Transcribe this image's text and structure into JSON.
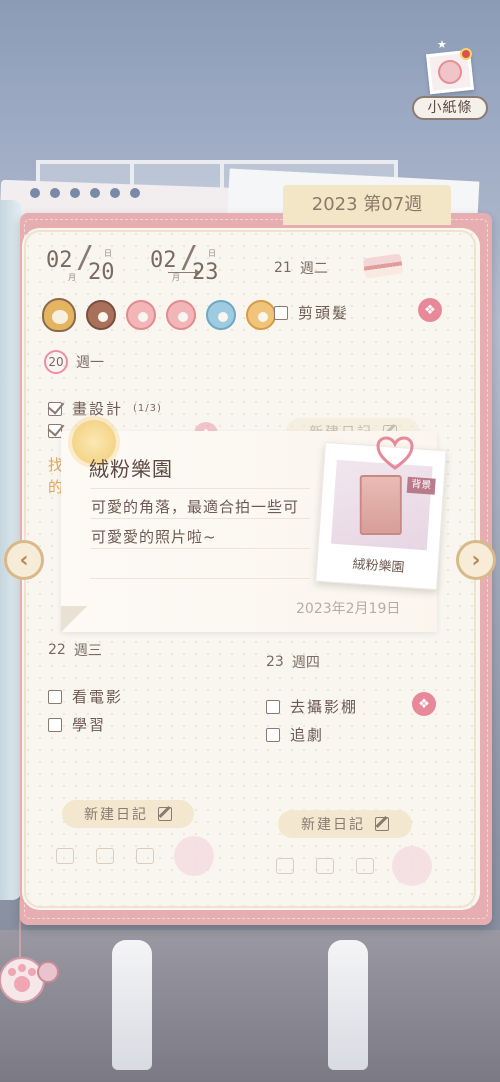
{
  "hud": {
    "note_label": "小紙條"
  },
  "planner": {
    "week_tab": "2023 第07週",
    "date_range": {
      "start_month": "02",
      "start_day": "20",
      "end_month": "02",
      "end_day": "23",
      "month_unit": "月",
      "day_unit": "日"
    },
    "days": [
      {
        "num": "20",
        "weekday": "週一",
        "tasks": [
          {
            "text": "畫設計",
            "progress": "(1/3)",
            "checked": true
          },
          {
            "text": "",
            "checked": true
          }
        ],
        "extra_text": [
          "找",
          "的"
        ]
      },
      {
        "num": "21",
        "weekday": "週二",
        "tasks": [
          {
            "text": "剪頭髮",
            "checked": false
          }
        ],
        "new_entry": "新建日記"
      },
      {
        "num": "22",
        "weekday": "週三",
        "tasks": [
          {
            "text": "看電影",
            "checked": false
          },
          {
            "text": "學習",
            "checked": false
          }
        ],
        "new_entry": "新建日記"
      },
      {
        "num": "23",
        "weekday": "週四",
        "tasks": [
          {
            "text": "去攝影棚",
            "checked": false
          },
          {
            "text": "追劇",
            "checked": false
          }
        ],
        "new_entry": "新建日記"
      }
    ],
    "nav_prev": "‹",
    "nav_next": "›"
  },
  "popup": {
    "title": "絨粉樂園",
    "body_line1": "可愛的角落，最適合拍一些可",
    "body_line2": "可愛愛的照片啦~",
    "date": "2023年2月19日",
    "polaroid_caption": "絨粉樂園",
    "polaroid_badge": "背景"
  },
  "colors": {
    "planner_frame": "#e7aeb1",
    "page_bg": "#f8f6ef",
    "accent_pink": "#e8899a",
    "text_brown": "#6d5a52",
    "tab_bg": "#f3e6c6"
  },
  "icons": {
    "gift": "gift-icon",
    "pencil": "pencil-icon",
    "heart": "heart-icon",
    "sun": "sun-sticker-icon"
  }
}
